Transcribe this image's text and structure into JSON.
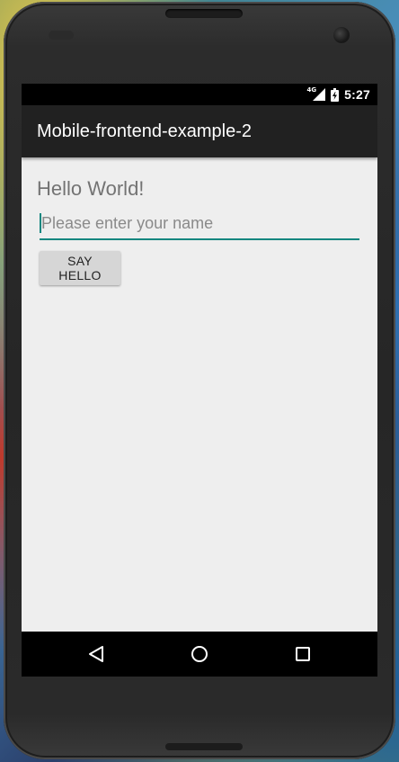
{
  "status_bar": {
    "network": "4G",
    "time": "5:27"
  },
  "app_bar": {
    "title": "Mobile-frontend-example-2"
  },
  "content": {
    "greeting": "Hello World!",
    "name_input": {
      "value": "",
      "placeholder": "Please enter your name"
    },
    "say_hello_label": "SAY HELLO"
  },
  "nav_bar": {
    "buttons": [
      "back-icon",
      "home-icon",
      "recents-icon"
    ]
  },
  "colors": {
    "accent": "#11867f",
    "app_bar": "#212121",
    "background": "#eeeeee",
    "button": "#d6d6d6"
  }
}
